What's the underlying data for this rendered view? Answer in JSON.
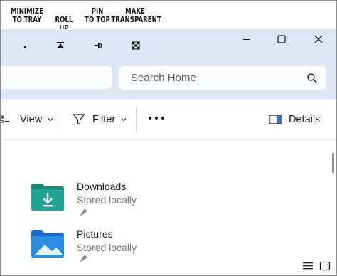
{
  "annotations": [
    {
      "id": "minimize-to-tray",
      "label": "MINIMIZE\nTO TRAY"
    },
    {
      "id": "roll-up",
      "label": "ROLL UP"
    },
    {
      "id": "pin-to-top",
      "label": "PIN\nTO TOP"
    },
    {
      "id": "make-transparent",
      "label": "MAKE\nTRANSPARENT"
    }
  ],
  "search": {
    "placeholder": "Search Home"
  },
  "commandbar": {
    "view_label": "View",
    "filter_label": "Filter",
    "details_label": "Details"
  },
  "items": [
    {
      "name": "Downloads",
      "status": "Stored locally",
      "icon": "downloads-folder-icon"
    },
    {
      "name": "Pictures",
      "status": "Stored locally",
      "icon": "pictures-folder-icon"
    }
  ],
  "colors": {
    "titlebar": "#dde6f4",
    "folder_teal": "#1f9c8c",
    "folder_blue": "#1e84d6"
  }
}
